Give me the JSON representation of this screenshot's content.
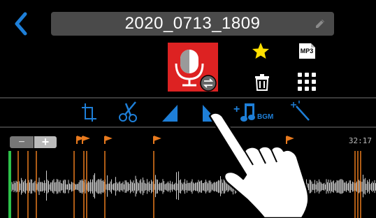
{
  "header": {
    "title": "2020_0713_1809"
  },
  "icons": {
    "back": "back-chevron-icon",
    "edit": "pencil-icon",
    "file": "microphone-recording-icon",
    "favorite": "star-icon",
    "format": "mp3-icon",
    "delete": "trash-icon",
    "menu": "grid-icon"
  },
  "file_badge": {
    "format_label": "MP3"
  },
  "tools": [
    {
      "name": "trim",
      "icon": "trim-icon"
    },
    {
      "name": "cut",
      "icon": "scissors-icon"
    },
    {
      "name": "fade-in",
      "icon": "fade-in-icon"
    },
    {
      "name": "fade-out",
      "icon": "fade-out-icon"
    },
    {
      "name": "bgm",
      "icon": "add-bgm-icon",
      "label": "BGM",
      "prefix": "+"
    },
    {
      "name": "effect",
      "icon": "magic-wand-icon"
    }
  ],
  "timeline": {
    "zoom_out_label": "−",
    "zoom_in_label": "+",
    "duration": "32:17"
  },
  "colors": {
    "accent": "#1e7fd8",
    "marker": "#e87a1e",
    "record_red": "#d22222",
    "star": "#ffe000",
    "playhead": "#2ec24a",
    "waveform": "#cfcfcf"
  }
}
